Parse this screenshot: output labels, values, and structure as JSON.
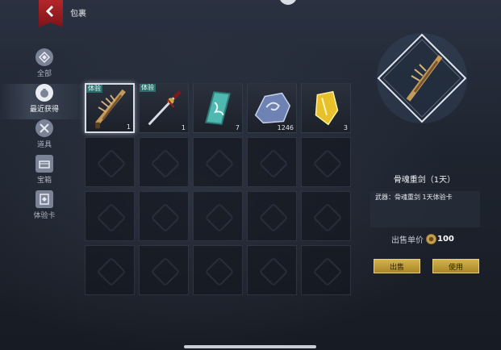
{
  "header": {
    "title": "包裹",
    "back_icon": "back-arrow-icon"
  },
  "sidebar": {
    "items": [
      {
        "label": "全部",
        "icon": "grid-icon",
        "active": false
      },
      {
        "label": "最近获得",
        "icon": "bag-icon",
        "active": true
      },
      {
        "label": "道具",
        "icon": "tools-icon",
        "active": false
      },
      {
        "label": "宝箱",
        "icon": "chest-icon",
        "active": false
      },
      {
        "label": "体验卡",
        "icon": "card-icon",
        "active": false
      }
    ]
  },
  "inventory": {
    "items": [
      {
        "name": "bone-greatsword",
        "tag": "体验",
        "qty": "1",
        "selected": true
      },
      {
        "name": "blade",
        "tag": "体验",
        "qty": "1",
        "selected": false
      },
      {
        "name": "jade-token",
        "tag": "",
        "qty": "7",
        "selected": false
      },
      {
        "name": "blue-ore",
        "tag": "",
        "qty": "1246",
        "selected": false
      },
      {
        "name": "gold-crystal",
        "tag": "",
        "qty": "3",
        "selected": false
      }
    ],
    "empty_slots": 15
  },
  "detail": {
    "name": "骨魂重剑（1天）",
    "description": "武器：骨魂重剑 1天体验卡",
    "price_label": "出售单价",
    "price_value": "100",
    "sell_label": "出售",
    "use_label": "使用"
  },
  "colors": {
    "accent_gold": "#c9a845",
    "tag_teal": "#2a6d6a",
    "back_red": "#a01f24"
  }
}
